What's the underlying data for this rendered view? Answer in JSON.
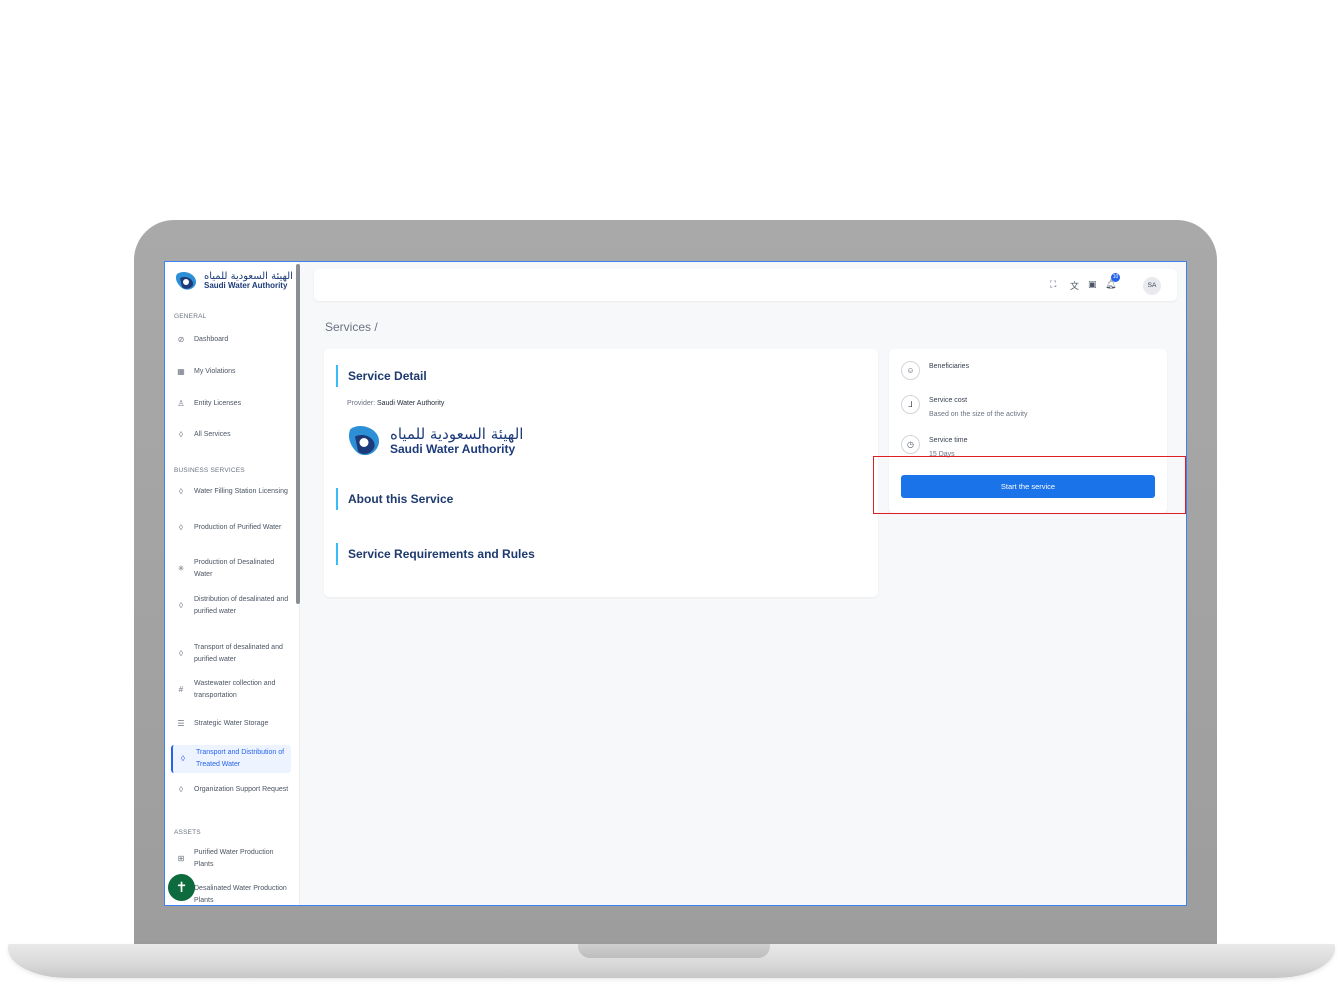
{
  "brand": {
    "arabic": "الهيئة السعودية للمياه",
    "english": "Saudi Water Authority"
  },
  "sidebar": {
    "sections": {
      "general": "GENERAL",
      "business": "BUSINESS SERVICES",
      "assets": "ASSETS"
    },
    "general_items": [
      {
        "label": "Dashboard",
        "icon": "dashboard-icon"
      },
      {
        "label": "My Violations",
        "icon": "grid-icon"
      },
      {
        "label": "Entity Licenses",
        "icon": "user-icon"
      },
      {
        "label": "All Services",
        "icon": "drop-icon"
      }
    ],
    "business_items": [
      {
        "label": "Water Filling Station Licensing",
        "icon": "drop-icon"
      },
      {
        "label": "Production of Purified Water",
        "icon": "drop-icon"
      },
      {
        "label": "Production of Desalinated Water",
        "icon": "snowflake-icon"
      },
      {
        "label": "Distribution of desalinated and purified water",
        "icon": "drop-icon"
      },
      {
        "label": "Transport of desalinated and purified water",
        "icon": "drop-icon"
      },
      {
        "label": "Wastewater collection and transportation",
        "icon": "grid-hash-icon"
      },
      {
        "label": "Strategic Water Storage",
        "icon": "storage-icon"
      },
      {
        "label": "Transport and Distribution of Treated Water",
        "icon": "drop-icon",
        "active": true
      },
      {
        "label": "Organization Support Request",
        "icon": "drop-icon"
      }
    ],
    "asset_items": [
      {
        "label": "Purified Water Production Plants",
        "icon": "table-icon"
      },
      {
        "label": "Desalinated Water Production Plants",
        "icon": "table-icon"
      }
    ]
  },
  "topbar": {
    "icons": [
      "fullscreen-icon",
      "translate-icon",
      "clipboard-icon",
      "bell-icon"
    ],
    "notification_count": "10",
    "avatar": "SA"
  },
  "breadcrumb": "Services /",
  "service": {
    "detail_title": "Service Detail",
    "provider_label": "Provider:",
    "provider_name": "Saudi Water Authority",
    "about_title": "About this Service",
    "requirements_title": "Service Requirements and Rules"
  },
  "side_info": {
    "beneficiaries": "Beneficiaries",
    "cost_title": "Service cost",
    "cost_value": "Based on the size of the activity",
    "time_title": "Service time",
    "time_value": "15 Days",
    "start_button": "Start the service"
  },
  "colors": {
    "accent": "#1a73e8",
    "brand": "#1d3b7a",
    "highlight": "#e11d24",
    "accessibility": "#0d6b3d"
  }
}
